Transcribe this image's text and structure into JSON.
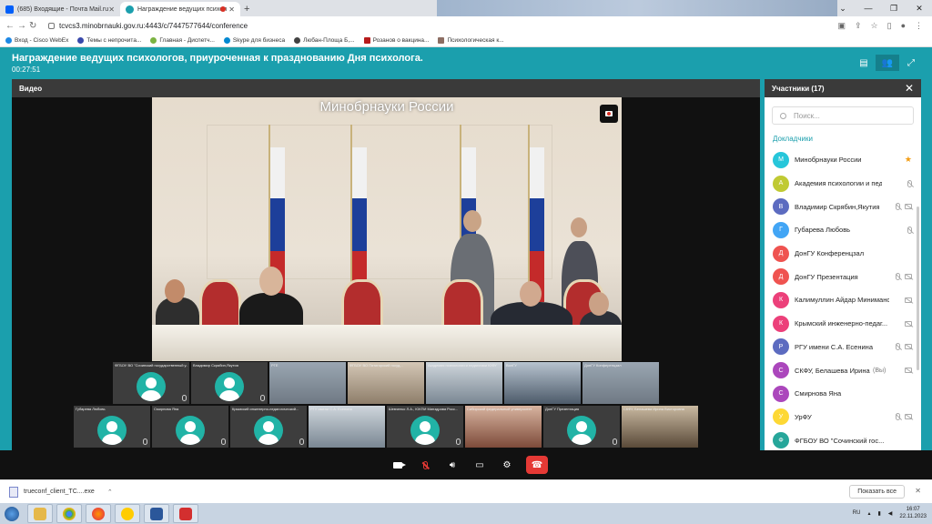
{
  "browser": {
    "tabs": [
      {
        "title": "(685) Входящие - Почта Mail.ru",
        "icon": "mail-icon",
        "color": "#005ff9"
      },
      {
        "title": "Награждение ведущих психол",
        "icon": "trueconf-icon",
        "color": "#1b9fad",
        "active": true,
        "recording": true
      }
    ],
    "url": "tcvcs3.minobrnauki.gov.ru:4443/c/7447577644/conference",
    "bookmarks": [
      {
        "label": "Вход - Cisco WebEx",
        "color": "#1e88e5"
      },
      {
        "label": "Темы с непрочита...",
        "color": "#3949ab"
      },
      {
        "label": "Главная - Диспетч...",
        "color": "#7cb342"
      },
      {
        "label": "Skype для бизнеса",
        "color": "#0288d1"
      },
      {
        "label": "Любан-Площа Б,...",
        "color": "#424242"
      },
      {
        "label": "Розанов о вакцина...",
        "color": "#b71c1c"
      },
      {
        "label": "Психологическая к...",
        "color": "#8d6e63"
      }
    ]
  },
  "conference": {
    "title": "Награждение ведущих психологов, приуроченная к празднованию Дня психолога.",
    "timer": "00:27:51",
    "video_label": "Видео",
    "main_speaker_label": "Минобрнауки России"
  },
  "thumbnails": [
    {
      "name": "ФГБОУ ВО \"Сочинский государственный у...",
      "type": "avatar"
    },
    {
      "name": "Владимир Скрябин,Якутия",
      "type": "avatar"
    },
    {
      "name": "РГЕ",
      "type": "photo"
    },
    {
      "name": "ФГБОУ ВО Пятигорский госуд...",
      "type": "photo2"
    },
    {
      "name": "Академия психологии и педагогики ЮФУ",
      "type": "photo3"
    },
    {
      "name": "ВолГУ",
      "type": "photo4"
    },
    {
      "name": "ДонГУ Конференцзал",
      "type": "photo"
    },
    {
      "name": "Губарева Любовь",
      "type": "avatar"
    },
    {
      "name": "Смирнова Яна",
      "type": "avatar"
    },
    {
      "name": "Крымский инженерно-педагогический...",
      "type": "avatar"
    },
    {
      "name": "РГУ имени С.А. Есенина",
      "type": "photo3"
    },
    {
      "name": "Шевченко Л.А., ЮКПИ Минздрава Росс...",
      "type": "avatar"
    },
    {
      "name": "Сибирский федеральный университет",
      "type": "photo5"
    },
    {
      "name": "ДонГУ Презентация",
      "type": "avatar"
    },
    {
      "name": "СКФУ, Белашева Ирина Викторовна",
      "type": "photo6"
    }
  ],
  "participants": {
    "title": "Участники (17)",
    "search_placeholder": "Поиск...",
    "section": "Докладчики",
    "items": [
      {
        "initial": "М",
        "name": "Минобрнауки России",
        "color": "#26c6da",
        "star": true
      },
      {
        "initial": "А",
        "name": "Академия психологии и педаг...",
        "color": "#c0ca33"
      },
      {
        "initial": "В",
        "name": "Владимир Скрябин,Якутия",
        "color": "#5c6bc0"
      },
      {
        "initial": "Г",
        "name": "Губарева Любовь",
        "color": "#42a5f5"
      },
      {
        "initial": "Д",
        "name": "ДонГУ Конференцзал",
        "color": "#ef5350"
      },
      {
        "initial": "Д",
        "name": "ДонГУ Презентация",
        "color": "#ef5350"
      },
      {
        "initial": "К",
        "name": "Калимуллин Айдар Минимансу...",
        "color": "#ec407a"
      },
      {
        "initial": "К",
        "name": "Крымский инженерно-педаг...",
        "color": "#ec407a"
      },
      {
        "initial": "Р",
        "name": "РГУ имени С.А. Есенина",
        "color": "#5c6bc0"
      },
      {
        "initial": "С",
        "name": "СКФУ, Белашева Ирина В...",
        "color": "#ab47bc",
        "extra": "(Вы)"
      },
      {
        "initial": "С",
        "name": "Смирнова Яна",
        "color": "#ab47bc"
      },
      {
        "initial": "У",
        "name": "УрФУ",
        "color": "#fdd835"
      },
      {
        "initial": "Ф",
        "name": "ФГБОУ ВО \"Сочинский гос...",
        "color": "#26a69a"
      }
    ]
  },
  "download": {
    "file": "trueconf_client_TC....exe",
    "show_all": "Показать все"
  },
  "taskbar": {
    "lang": "RU",
    "time": "16:07",
    "date": "22.11.2023"
  }
}
